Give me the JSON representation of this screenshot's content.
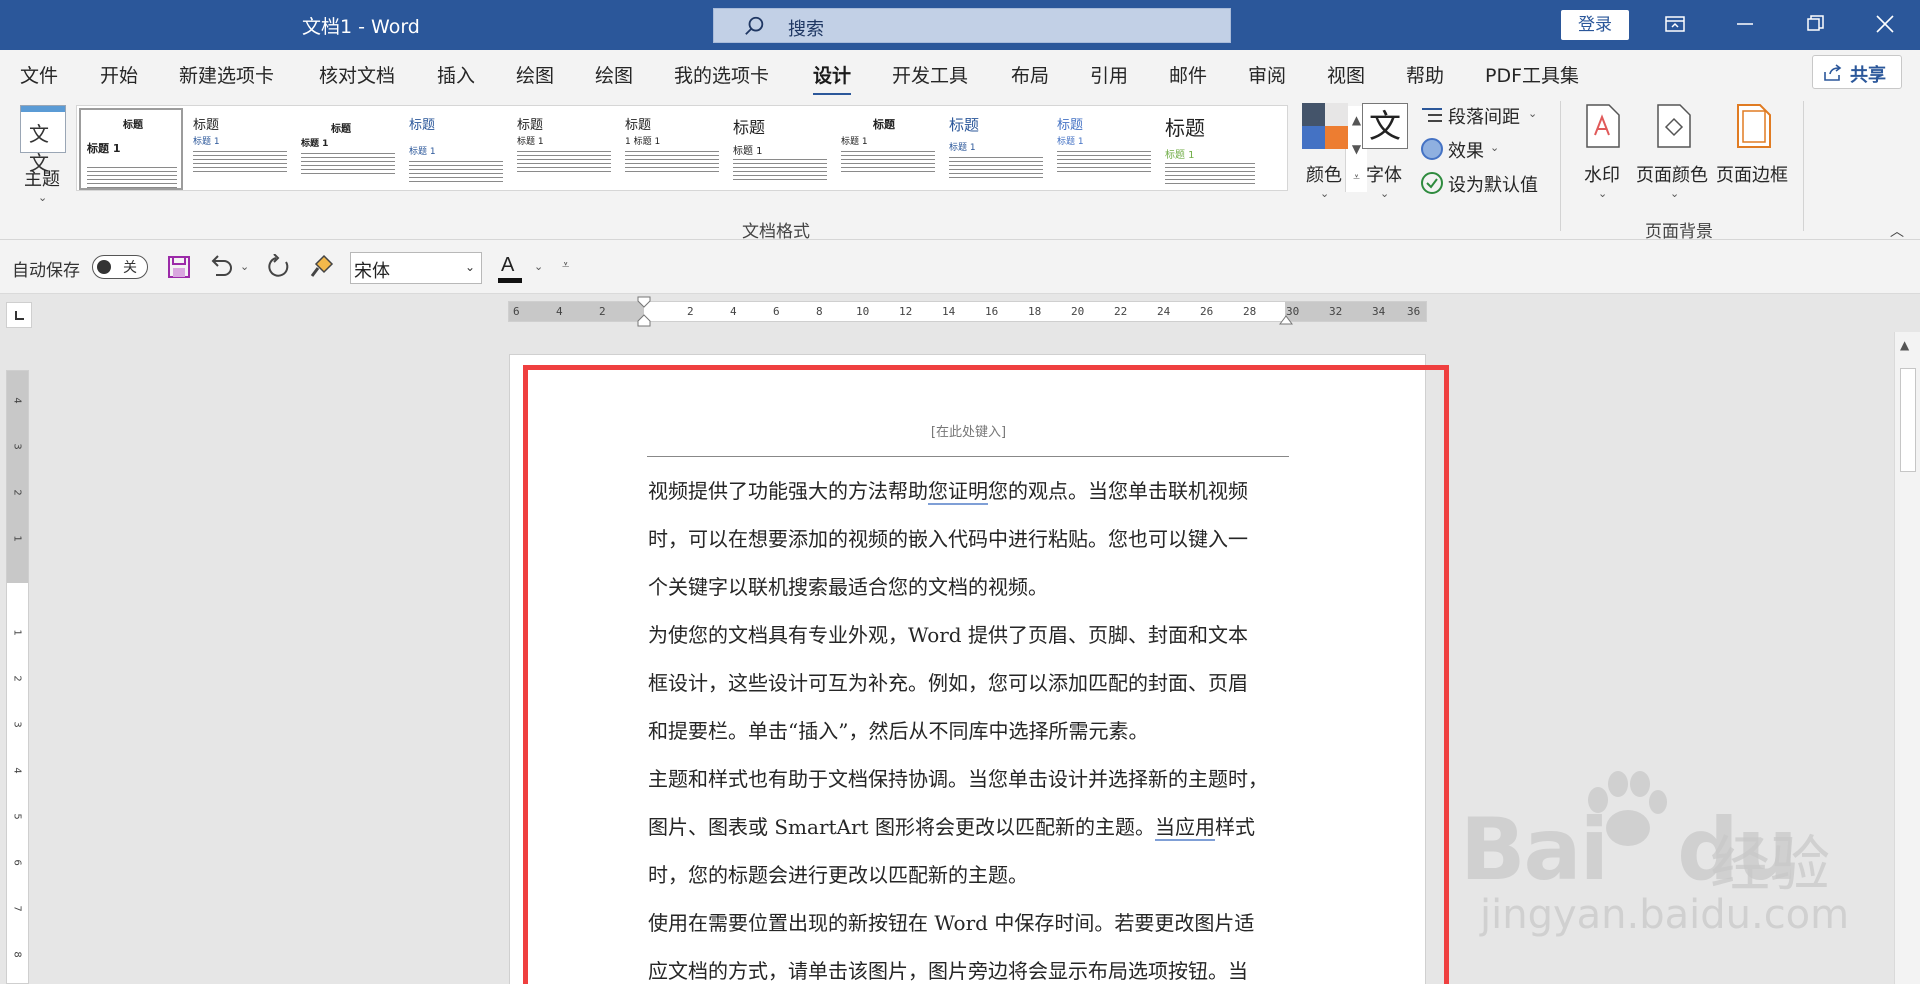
{
  "app": {
    "window_title": "文档1  -  Word",
    "search_label": "搜索",
    "login_label": "登录"
  },
  "menu": {
    "tabs": [
      {
        "label": "文件"
      },
      {
        "label": "开始"
      },
      {
        "label": "新建选项卡"
      },
      {
        "label": "核对文档"
      },
      {
        "label": "插入"
      },
      {
        "label": "绘图"
      },
      {
        "label": "绘图"
      },
      {
        "label": "我的选项卡"
      },
      {
        "label": "设计",
        "active": true
      },
      {
        "label": "开发工具"
      },
      {
        "label": "布局"
      },
      {
        "label": "引用"
      },
      {
        "label": "邮件"
      },
      {
        "label": "审阅"
      },
      {
        "label": "视图"
      },
      {
        "label": "帮助"
      },
      {
        "label": "PDF工具集"
      }
    ],
    "share_label": "共享"
  },
  "ribbon": {
    "theme_label": "主题",
    "theme_icon_text": "文文",
    "style_gallery": [
      {
        "title": "标题",
        "subtitle": "标题 1"
      },
      {
        "title": "标题",
        "subtitle": "标题 1"
      },
      {
        "title": "标题",
        "subtitle": "标题 1"
      },
      {
        "title": "标题",
        "subtitle": "标题 1"
      },
      {
        "title": "标题",
        "subtitle": "标题 1"
      },
      {
        "title": "标题",
        "subtitle": "1  标题 1"
      },
      {
        "title": "标题",
        "subtitle": "标题 1"
      },
      {
        "title": "标题",
        "subtitle": "标题 1"
      },
      {
        "title": "标题",
        "subtitle": "标题 1"
      },
      {
        "title": "标题",
        "subtitle": "标题 1"
      },
      {
        "title": "标题",
        "subtitle": "标题 1"
      }
    ],
    "group_document_format": "文档格式",
    "colors_label": "颜色",
    "fonts_label": "字体",
    "fonts_icon_text": "文",
    "paragraph_spacing_label": "段落间距",
    "effects_label": "效果",
    "set_default_label": "设为默认值",
    "watermark_label": "水印",
    "page_color_label": "页面颜色",
    "page_border_label": "页面边框",
    "group_page_background": "页面背景",
    "accent_color": "#2b579a"
  },
  "qat": {
    "autosave_label": "自动保存",
    "autosave_state": "关",
    "font_name": "宋体",
    "font_color_letter": "A"
  },
  "ruler": {
    "h_ticks": [
      "6",
      "4",
      "2",
      "2",
      "4",
      "6",
      "8",
      "10",
      "12",
      "14",
      "16",
      "18",
      "20",
      "22",
      "24",
      "26",
      "28",
      "30",
      "32",
      "34",
      "36"
    ],
    "v_ticks": [
      "4",
      "3",
      "2",
      "1",
      "1",
      "2",
      "3",
      "4",
      "5",
      "6",
      "7",
      "8"
    ]
  },
  "document": {
    "header_placeholder": "[在此处键入]",
    "paragraphs": [
      {
        "lines": [
          [
            "视频提供了功能强大的方法帮助",
            "您证明",
            "您的观点。当您单击联机视频"
          ],
          [
            "时，可以在想要添加的视频的嵌入代码中进行粘贴。您也可以键入一"
          ],
          [
            "个关键字以联机搜索最适合您的文档的视频。"
          ]
        ]
      },
      {
        "lines": [
          [
            "为使您的文档具有专业外观，Word 提供了页眉、页脚、封面和文本"
          ],
          [
            "框设计，这些设计可互为补充。例如，您可以添加匹配的封面、页眉"
          ],
          [
            "和提要栏。单击“插入”，然后从不同库中选择所需元素。"
          ]
        ]
      },
      {
        "lines": [
          [
            "主题和样式也有助于文档保持协调。当您单击设计并选择新的主题时，"
          ],
          [
            "图片、图表或 SmartArt 图形将会更改以匹配新的主题。",
            "当应用",
            "样式"
          ],
          [
            "时，您的标题会进行更改以匹配新的主题。"
          ]
        ]
      },
      {
        "lines": [
          [
            "使用在需要位置出现的新按钮在 Word 中保存时间。若要更改图片适"
          ],
          [
            "应文档的方式，请单击该图片，图片旁边将会显示布局选项按钮。当"
          ]
        ]
      }
    ]
  },
  "watermark": {
    "brand": "Bai",
    "brand2": "du",
    "cn": "经验",
    "url": "jingyan.baidu.com"
  }
}
